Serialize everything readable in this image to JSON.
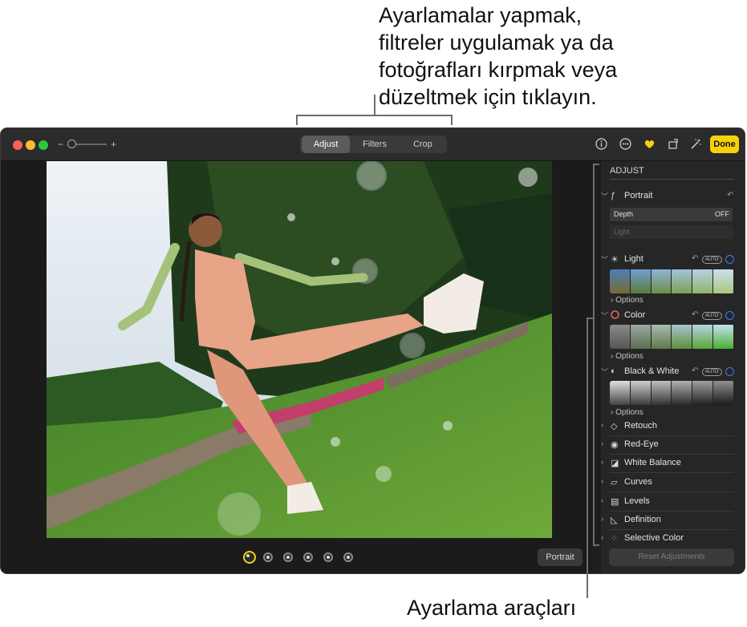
{
  "callouts": {
    "top": "Ayarlamalar yapmak,\nfiltreler uygulamak ya da\nfotoğrafları kırpmak veya\ndüzeltmek için tıklayın.",
    "bottom": "Ayarlama araçları"
  },
  "toolbar": {
    "zoom_minus": "−",
    "zoom_plus": "+",
    "tabs": [
      "Adjust",
      "Filters",
      "Crop"
    ],
    "done_label": "Done"
  },
  "panel": {
    "title": "ADJUST",
    "portrait": {
      "label": "Portrait",
      "depth_label": "Depth",
      "depth_value": "OFF",
      "light_label": "Light"
    },
    "sections": [
      {
        "label": "Light",
        "auto": "AUTO",
        "options": "Options"
      },
      {
        "label": "Color",
        "auto": "AUTO",
        "options": "Options"
      },
      {
        "label": "Black & White",
        "auto": "AUTO",
        "options": "Options"
      }
    ],
    "tools": [
      "Retouch",
      "Red-Eye",
      "White Balance",
      "Curves",
      "Levels",
      "Definition",
      "Selective Color"
    ],
    "reset_label": "Reset Adjustments"
  },
  "canvas": {
    "portrait_button": "Portrait"
  },
  "colors": {
    "done": "#f7d10c",
    "accent_ring": "#3b82f6",
    "favorite": "#f7d10c"
  }
}
